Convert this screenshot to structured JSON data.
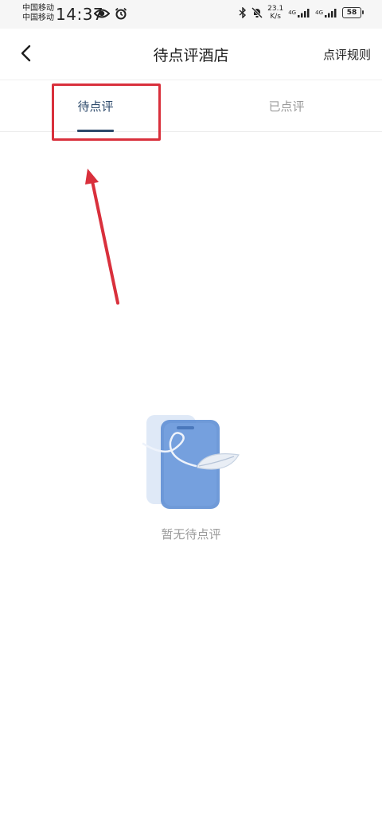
{
  "status_bar": {
    "carrier_1": "中国移动",
    "carrier_2": "中国移动",
    "time": "14:37",
    "net_speed_value": "23.1",
    "net_speed_unit": "K/s",
    "signal_1_label": "4G",
    "signal_2_label": "4G",
    "battery": "58",
    "icons": [
      "eye-icon",
      "alarm-icon",
      "bluetooth-icon",
      "mute-bell-icon",
      "signal-icon",
      "battery-icon"
    ]
  },
  "nav": {
    "title": "待点评酒店",
    "action": "点评规则",
    "back_icon": "chevron-left-icon"
  },
  "tabs": [
    {
      "label": "待点评",
      "active": true
    },
    {
      "label": "已点评",
      "active": false
    }
  ],
  "empty_state": {
    "text": "暂无待点评",
    "icon": "phone-with-leaf-illustration"
  },
  "colors": {
    "accent": "#2d4a6b",
    "annotation_red": "#d9303c",
    "inactive_text": "#9a9a9a",
    "illustration_blue": "#5f8fd4"
  }
}
